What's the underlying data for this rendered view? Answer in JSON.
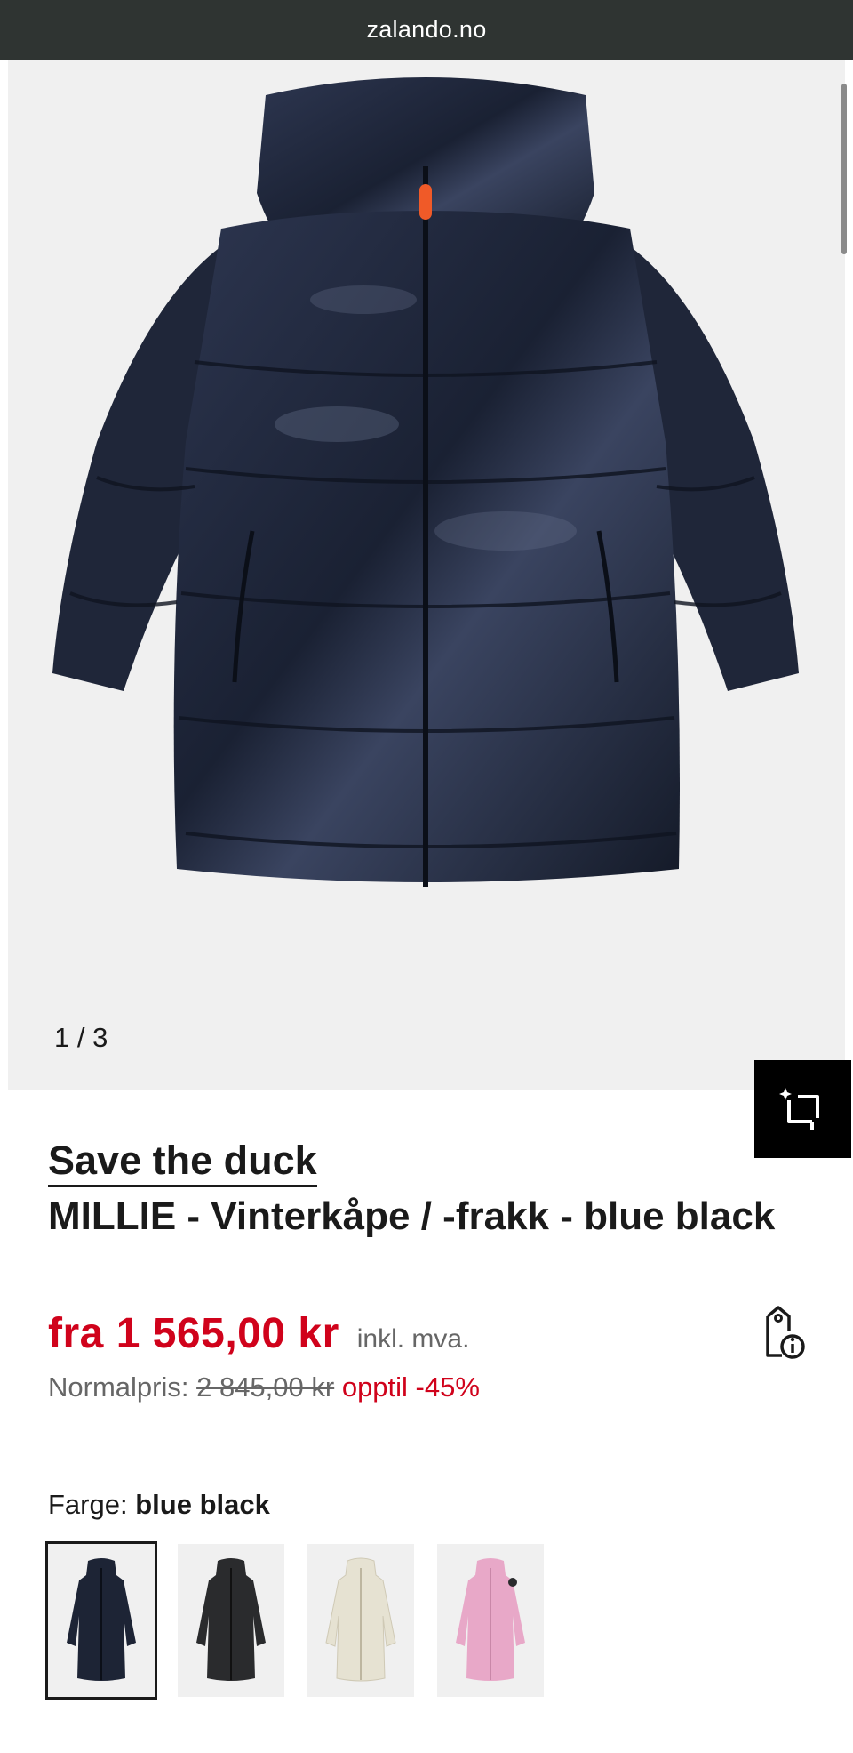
{
  "browser": {
    "url": "zalando.no"
  },
  "gallery": {
    "counter": "1 / 3"
  },
  "product": {
    "brand": "Save the duck",
    "name": "MILLIE - Vinterkåpe / -frakk - blue black",
    "price": "fra 1 565,00 kr",
    "vat_note": "inkl. mva.",
    "normal_label": "Normalpris:",
    "normal_price": "2 845,00 kr",
    "discount": "opptil -45%"
  },
  "color": {
    "label": "Farge:",
    "selected": "blue black",
    "swatches": [
      {
        "color": "#1d2435",
        "selected": true
      },
      {
        "color": "#2a2b2d",
        "selected": false
      },
      {
        "color": "#e6e2d2",
        "selected": false
      },
      {
        "color": "#e8a8c8",
        "selected": false
      }
    ]
  },
  "icons": {
    "crop": "crop-sparkle-icon",
    "price_info": "price-tag-info-icon"
  },
  "colors": {
    "sale_red": "#d0021b",
    "url_bar": "#2f3432",
    "coat": "#1d2435"
  }
}
